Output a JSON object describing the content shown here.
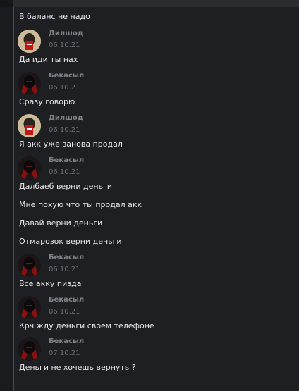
{
  "users": {
    "dilshod": "Дилшод",
    "bekasyl": "Бекасыл"
  },
  "messages": {
    "m0": "В баланс не надо",
    "m1": "Да иди ты нах",
    "m2": "Сразу говорю",
    "m3": "Я акк уже занова продал",
    "m4": "Далбаеб верни деньги",
    "m5": "Мне похую что ты продал акк",
    "m6": "Давай верни деньги",
    "m7": "Отмарозок верни деньги",
    "m8": "Все акку пизда",
    "m9": "Крч жду деньги своем телефоне",
    "m10": "Деньги не хочешь вернуть ?"
  },
  "dates": {
    "d1": "06.10.21",
    "d2": "06.10.21",
    "d3": "06.10.21",
    "d4": "06.10.21",
    "d5": "06.10.21",
    "d6": "06.10.21",
    "d7": "07.10.21"
  }
}
